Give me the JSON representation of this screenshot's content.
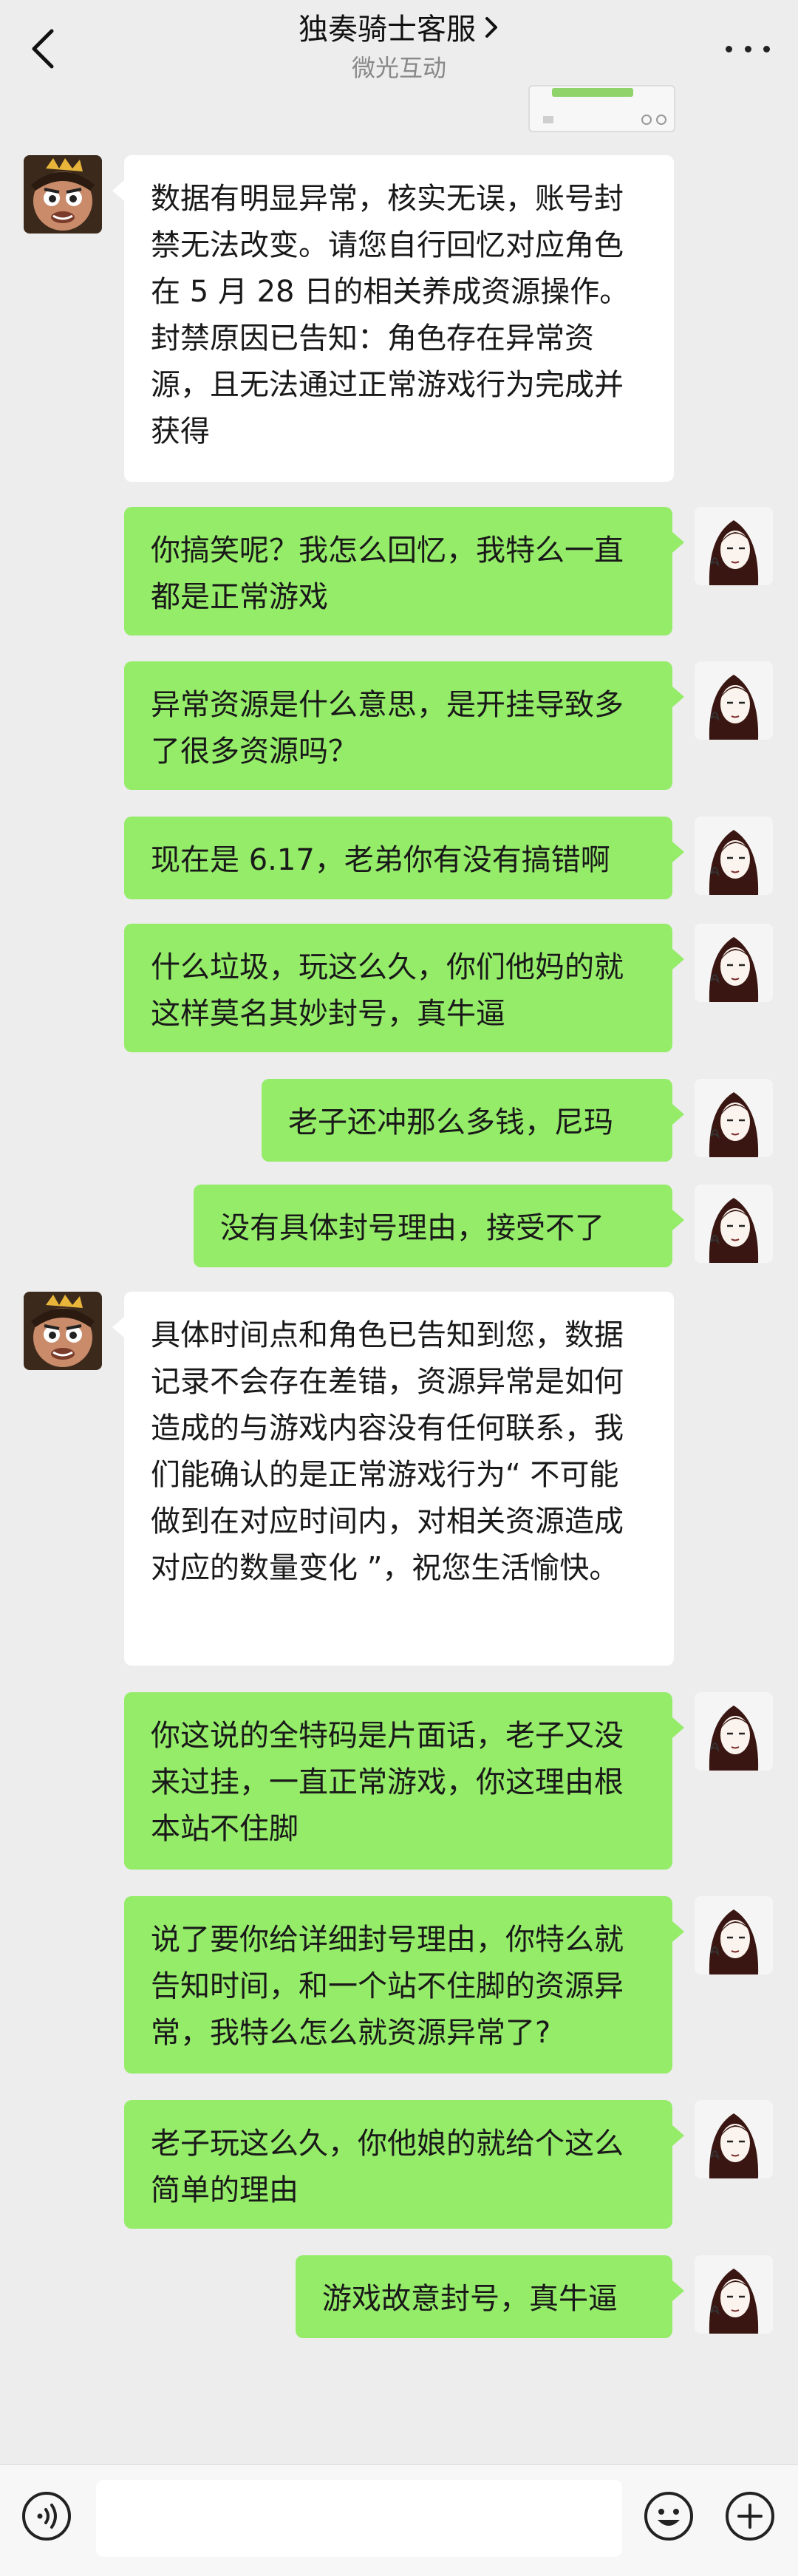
{
  "header": {
    "title": "独奏骑士客服",
    "subtitle": "微光互动"
  },
  "messages": [
    {
      "side": "left",
      "text": "数据有明显异常，核实无误，账号封禁无法改变。请您自行回忆对应角色在 5 月 28 日的相关养成资源操作。封禁原因已告知：角色存在异常资源，且无法通过正常游戏行为完成并获得"
    },
    {
      "side": "right",
      "text": "你搞笑呢？我怎么回忆，我特么一直都是正常游戏"
    },
    {
      "side": "right",
      "text": "异常资源是什么意思，是开挂导致多了很多资源吗？"
    },
    {
      "side": "right",
      "text": "现在是 6.17，老弟你有没有搞错啊"
    },
    {
      "side": "right",
      "text": "什么垃圾，玩这么久，你们他妈的就这样莫名其妙封号，真牛逼"
    },
    {
      "side": "right",
      "text": "老子还冲那么多钱，尼玛"
    },
    {
      "side": "right",
      "text": "没有具体封号理由，接受不了"
    },
    {
      "side": "left",
      "text": "具体时间点和角色已告知到您，数据记录不会存在差错，资源异常是如何造成的与游戏内容没有任何联系，我们能确认的是正常游戏行为“ 不可能做到在对应时间内，对相关资源造成对应的数量变化 ”，祝您生活愉快。"
    },
    {
      "side": "right",
      "text": "你这说的全特码是片面话，老子又没来过挂，一直正常游戏，你这理由根本站不住脚"
    },
    {
      "side": "right",
      "text": "说了要你给详细封号理由，你特么就告知时间，和一个站不住脚的资源异常，我特么怎么就资源异常了?"
    },
    {
      "side": "right",
      "text": "老子玩这么久，你他娘的就给个这么简单的理由"
    },
    {
      "side": "right",
      "text": "游戏故意封号，真牛逼"
    }
  ],
  "input": {
    "value": ""
  },
  "icons": {
    "back": "chevron-left-icon",
    "title_arrow": "chevron-right-icon",
    "more": "more-dots-icon",
    "voice": "voice-icon",
    "emoji": "emoji-icon",
    "plus": "plus-icon"
  },
  "colors": {
    "background": "#ededed",
    "outgoing_bubble": "#95ec69",
    "incoming_bubble": "#ffffff"
  }
}
